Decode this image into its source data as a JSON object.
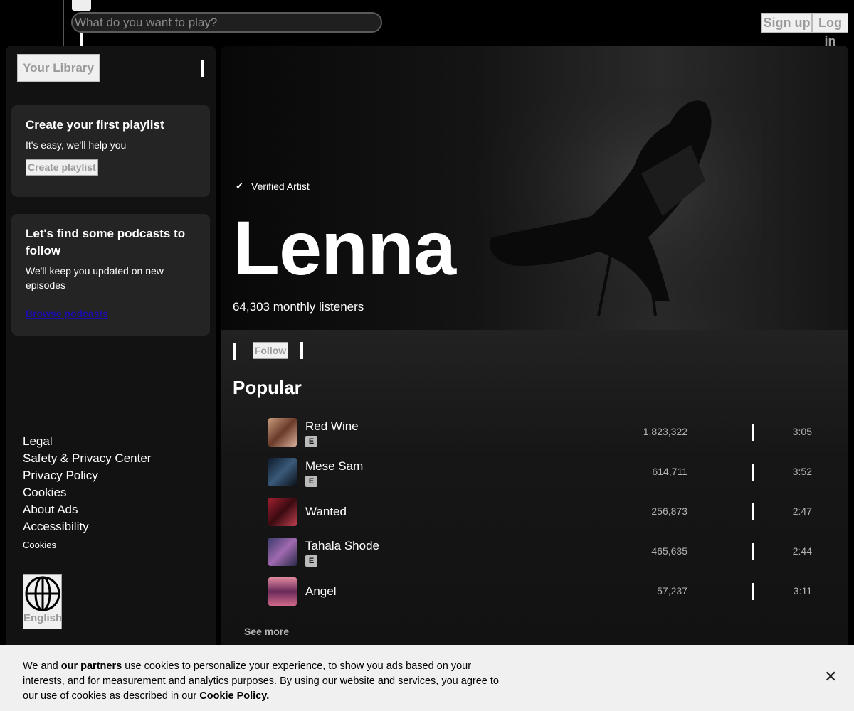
{
  "topbar": {
    "search_placeholder": "What do you want to play?",
    "signup_label": "Sign up",
    "login_label": "Log in"
  },
  "sidebar": {
    "library_label": "Your Library",
    "playlist_card": {
      "title": "Create your first playlist",
      "text": "It's easy, we'll help you",
      "button_label": "Create playlist"
    },
    "podcast_card": {
      "title": "Let's find some podcasts to follow",
      "text": "We'll keep you updated on new episodes",
      "link_label": "Browse podcasts"
    },
    "footer_links": [
      "Legal",
      "Safety & Privacy Center",
      "Privacy Policy",
      "Cookies",
      "About Ads",
      "Accessibility"
    ],
    "footer_small": "Cookies",
    "language_label": "English",
    "language_icon": "globe-icon"
  },
  "artist": {
    "verified_label": "Verified Artist",
    "name": "Lenna",
    "monthly_listeners": "64,303 monthly listeners",
    "follow_label": "Follow"
  },
  "popular": {
    "title": "Popular",
    "see_more": "See more",
    "tracks": [
      {
        "name": "Red Wine",
        "explicit": "E",
        "plays": "1,823,322",
        "duration": "3:05",
        "thumb_color": "#8a6a5a"
      },
      {
        "name": "Mese Sam",
        "explicit": "E",
        "plays": "614,711",
        "duration": "3:52",
        "thumb_color": "#1e2e40"
      },
      {
        "name": "Wanted",
        "explicit": "",
        "plays": "256,873",
        "duration": "2:47",
        "thumb_color": "#7a2028"
      },
      {
        "name": "Tahala Shode",
        "explicit": "E",
        "plays": "465,635",
        "duration": "2:44",
        "thumb_color": "#5a4a8a"
      },
      {
        "name": "Angel",
        "explicit": "",
        "plays": "57,237",
        "duration": "3:11",
        "thumb_color": "#c06a8a"
      }
    ]
  },
  "cookie_banner": {
    "text_1": "We and ",
    "partners_link": "our partners",
    "text_2": " use cookies to personalize your experience, to show you ads based on your interests, and for measurement and analytics purposes. By using our website and services, you agree to our use of cookies as described in our ",
    "policy_link": "Cookie Policy.",
    "close_icon": "close-icon"
  }
}
